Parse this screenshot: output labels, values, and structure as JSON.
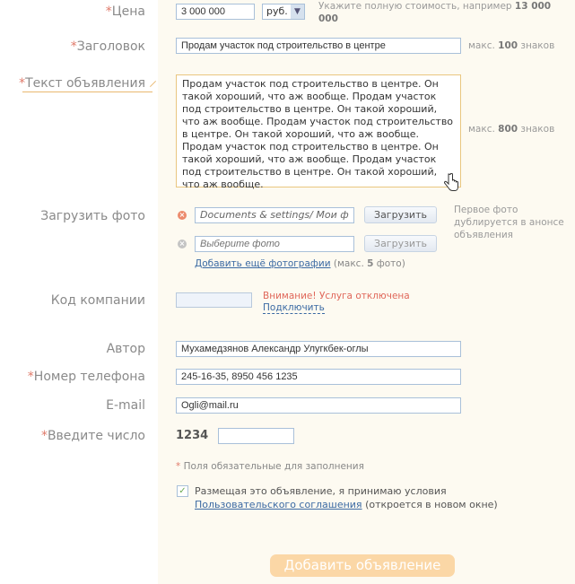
{
  "price": {
    "label": "Цена",
    "value": "3 000 000",
    "currency": "руб.",
    "hint_text": "Укажите полную стоимость, например",
    "hint_example": "13 000 000"
  },
  "title": {
    "label": "Заголовок",
    "value": "Продам участок под строительство в центре",
    "hint_prefix": "макс.",
    "hint_value": "100",
    "hint_suffix": "знаков"
  },
  "text": {
    "label": "Текст объявления",
    "value": "Продам участок под строительство в центре. Он такой хороший, что аж вообще. Продам участок под строительство в центре. Он такой хороший, что аж вообще. Продам участок под строительство в центре. Он такой хороший, что аж вообще. Продам участок под строительство в центре. Он такой хороший, что аж вообще. Продам участок под строительство в центре. Он такой хороший, что аж вообще.",
    "hint_prefix": "макс.",
    "hint_value": "800",
    "hint_suffix": "знаков"
  },
  "photo": {
    "label": "Загрузить фото",
    "file1": "Documents & settings/ Мои ф",
    "file2_placeholder": "Выберите фото",
    "upload_button": "Загрузить",
    "add_more_link": "Добавить ещё фотографии",
    "limit_prefix": "(макс.",
    "limit_value": "5",
    "limit_suffix": "фото)",
    "side_hint": "Первое фото дублируется в анонсе объявления"
  },
  "company": {
    "label": "Код компании",
    "warning": "Внимание! Услуга отключена",
    "connect_link": "Подключить"
  },
  "author": {
    "label": "Автор",
    "value": "Мухамедзянов Александр Улугкбек-оглы"
  },
  "phone": {
    "label": "Номер телефона",
    "value": "245-16-35, 8950 456 1235"
  },
  "email": {
    "label": "E-mail",
    "value": "Ogli@mail.ru"
  },
  "captcha": {
    "label": "Введите число",
    "number": "1234"
  },
  "required_note": "Поля обязательные для заполнения",
  "agreement": {
    "text": "Размещая это объявление, я принимаю условия",
    "link": "Пользовательского соглашения",
    "suffix": "(откроется в новом окне)"
  },
  "submit_label": "Добавить объявление",
  "colors": {
    "required": "#e07a6a",
    "link": "#3b6aa3",
    "submit_bg": "#fbd7a6",
    "panel_bg": "#fdfaf1"
  }
}
